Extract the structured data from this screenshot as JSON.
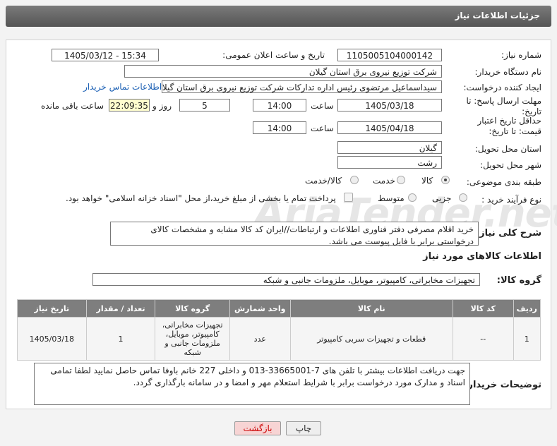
{
  "header": {
    "title": "جزئیات اطلاعات نیاز"
  },
  "labels": {
    "need_number": "شماره نیاز:",
    "announce_datetime": "تاریخ و ساعت اعلان عمومی:",
    "buyer_org": "نام دستگاه خریدار:",
    "requester": "ایجاد کننده درخواست:",
    "reply_deadline": "مهلت ارسال پاسخ: تا تاریخ:",
    "validity_deadline": "حداقل تاریخ اعتبار قیمت: تا تاریخ:",
    "time": "ساعت",
    "days_and": "روز و",
    "remaining": "ساعت باقی مانده",
    "province": "استان محل تحویل:",
    "city": "شهر محل تحویل:",
    "category": "طبقه بندی موضوعی:",
    "purchase_type": "نوع فرآیند خرید :",
    "description": "شرح کلی نیاز:",
    "goods_info": "اطلاعات کالاهای مورد نیاز",
    "goods_group": "گروه کالا:",
    "buyer_notes": "توضیحات خریدار:"
  },
  "values": {
    "need_number": "1105005104000142",
    "announce_datetime": "1405/03/12 - 15:34",
    "buyer_org": "شرکت توزیع نیروی برق استان گیلان",
    "requester": "سیداسماعیل مرتضوی رئیس اداره تدارکات شرکت توزیع نیروی برق استان گیلان",
    "contact_link": "اطلاعات تماس خریدار",
    "reply_date": "1405/03/18",
    "reply_time": "14:00",
    "days": "5",
    "remaining_time": "22:09:35",
    "validity_date": "1405/04/18",
    "validity_time": "14:00",
    "province": "گیلان",
    "city": "رشت",
    "description": "خرید اقلام مصرفی دفتر فناوری اطلاعات و ارتباطات//ایران کد کالا مشابه و مشخصات کالای درخواستی برابر با فایل پیوست می باشد.",
    "goods_group": "تجهیزات مخابراتی، کامپیوتر، موبایل، ملزومات جانبی و شبکه",
    "buyer_notes": "جهت دریافت اطلاعات بیشتر با تلفن های 7-33665001-013 و داخلی 227 خانم باوفا تماس حاصل نمایید لطفا تمامی اسناد و مدارک مورد درخواست برابر با شرایط استعلام مهر و امضا و در سامانه بارگذاری گردد."
  },
  "category_options": [
    {
      "label": "کالا",
      "selected": true
    },
    {
      "label": "خدمت",
      "selected": false
    },
    {
      "label": "کالا/خدمت",
      "selected": false
    }
  ],
  "purchase_options": [
    {
      "label": "جزیی",
      "selected": false
    },
    {
      "label": "متوسط",
      "selected": false
    }
  ],
  "payment_note": "پرداخت تمام یا بخشی از مبلغ خرید،از محل \"اسناد خزانه اسلامی\" خواهد بود.",
  "table": {
    "headers": [
      "ردیف",
      "کد کالا",
      "نام کالا",
      "واحد شمارش",
      "گروه کالا",
      "تعداد / مقدار",
      "تاریخ نیاز"
    ],
    "rows": [
      [
        "1",
        "--",
        "قطعات و تجهیزات سربی کامپیوتر",
        "عدد",
        "تجهیزات مخابراتی، کامپیوتر، موبایل، ملزومات جانبی و شبکه",
        "1",
        "1405/03/18"
      ]
    ]
  },
  "buttons": {
    "print": "چاپ",
    "back": "بازگشت"
  },
  "watermark": "AriaTender.net"
}
